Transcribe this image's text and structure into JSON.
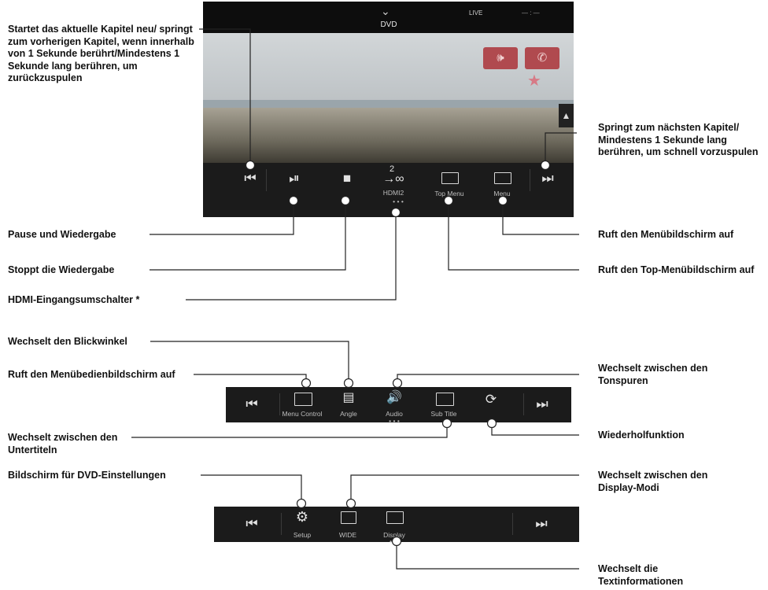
{
  "screen1": {
    "source": "DVD",
    "live": "LIVE",
    "buttons": {
      "hdmi": "HDMI2",
      "hdmi_num": "2",
      "top_menu": "Top Menu",
      "menu": "Menu"
    }
  },
  "bar2": {
    "menu_control": "Menu Control",
    "angle": "Angle",
    "audio": "Audio",
    "sub_title": "Sub Title"
  },
  "bar3": {
    "setup": "Setup",
    "wide": "WIDE",
    "display": "Display"
  },
  "labels": {
    "prev": "Startet das aktuelle Kapitel neu/ springt zum vorherigen Kapitel, wenn innerhalb von 1 Sekunde berührt/Mindestens 1 Sekunde lang berühren, um zurückzuspulen",
    "next": "Springt zum nächsten Kapitel/ Mindestens 1 Sekunde lang berühren, um schnell vorzuspulen",
    "pause": "Pause und Wiedergabe",
    "stop": "Stoppt die Wiedergabe",
    "hdmi": "HDMI-Eingangsumschalter *",
    "menu": "Ruft den Menübildschirm auf",
    "top_menu": "Ruft den Top-Menübildschirm auf",
    "angle": "Wechselt den Blickwinkel",
    "menu_control": "Ruft den Menübedienbildschirm auf",
    "audio": "Wechselt zwischen den Tonspuren",
    "subtitle": "Wechselt zwischen den Untertiteln",
    "repeat": "Wiederholfunktion",
    "setup": "Bildschirm für DVD-Einstellungen",
    "wide": "Wechselt zwischen den Display-Modi",
    "display": "Wechselt die Textinformationen"
  }
}
